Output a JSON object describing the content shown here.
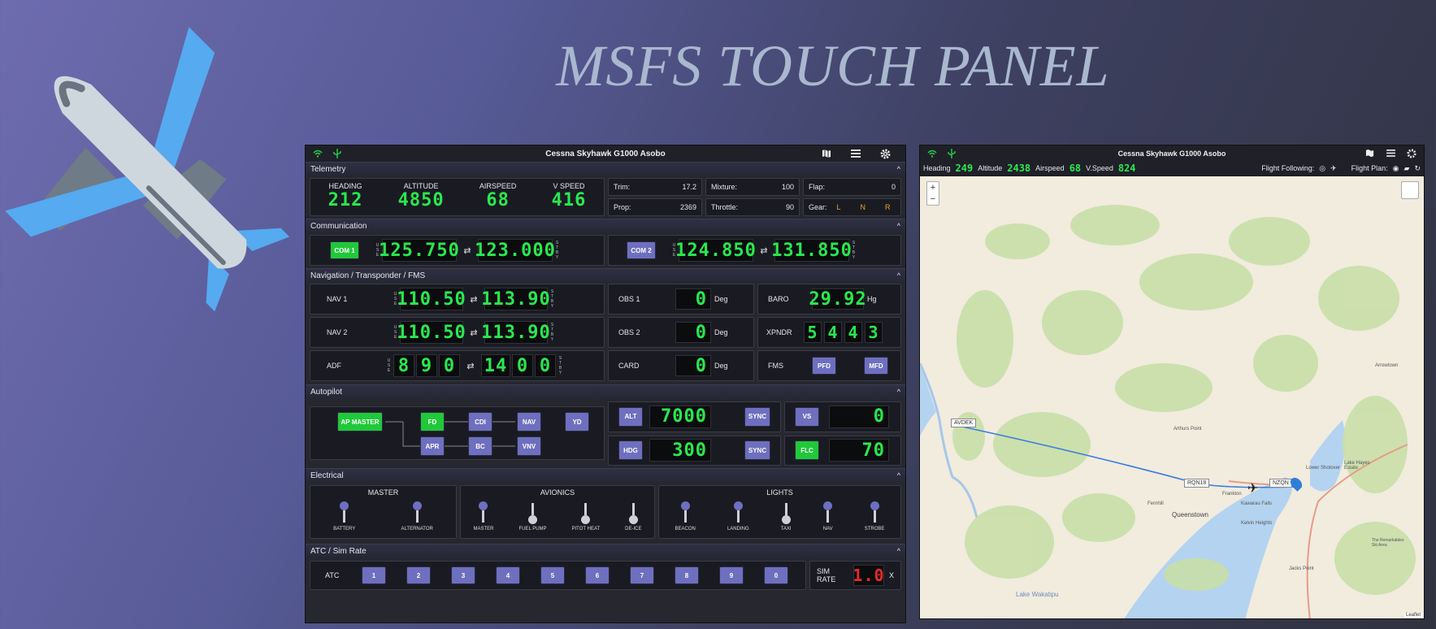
{
  "title": "MSFS TOUCH PANEL",
  "panel": {
    "aircraft": "Cessna Skyhawk G1000 Asobo",
    "telemetry": {
      "header": "Telemetry",
      "gauges": [
        {
          "label": "HEADING",
          "value": "212"
        },
        {
          "label": "ALTITUDE",
          "value": "4850"
        },
        {
          "label": "AIRSPEED",
          "value": "68"
        },
        {
          "label": "V SPEED",
          "value": "416"
        }
      ],
      "trim_label": "Trim:",
      "trim": "17.2",
      "mixture_label": "Mixture:",
      "mixture": "100",
      "flap_label": "Flap:",
      "flap": "0",
      "prop_label": "Prop:",
      "prop": "2369",
      "throttle_label": "Throttle:",
      "throttle": "90",
      "gear_label": "Gear:",
      "gear": [
        "L",
        "N",
        "R"
      ]
    },
    "communication": {
      "header": "Communication",
      "com1": {
        "label": "COM 1",
        "active": "125.750",
        "standby": "123.000"
      },
      "com2": {
        "label": "COM 2",
        "active": "124.850",
        "standby": "131.850"
      },
      "use": "USE",
      "stby": "STBY"
    },
    "navigation": {
      "header": "Navigation / Transponder / FMS",
      "nav1": {
        "label": "NAV 1",
        "active": "110.50",
        "standby": "113.90"
      },
      "nav2": {
        "label": "NAV 2",
        "active": "110.50",
        "standby": "113.90"
      },
      "adf": {
        "label": "ADF",
        "active": [
          "8",
          "9",
          "0"
        ],
        "standby": [
          "14",
          "0",
          "0"
        ]
      },
      "obs1": {
        "label": "OBS 1",
        "value": "0",
        "unit": "Deg"
      },
      "obs2": {
        "label": "OBS 2",
        "value": "0",
        "unit": "Deg"
      },
      "card": {
        "label": "CARD",
        "value": "0",
        "unit": "Deg"
      },
      "baro": {
        "label": "BARO",
        "value": "29.92",
        "unit": "Hg"
      },
      "xpndr": {
        "label": "XPNDR",
        "digits": [
          "5",
          "4",
          "4",
          "3"
        ]
      },
      "fms": {
        "label": "FMS",
        "pfd": "PFD",
        "mfd": "MFD"
      }
    },
    "autopilot": {
      "header": "Autopilot",
      "master": "AP MASTER",
      "fd": "FD",
      "cdi": "CDI",
      "nav": "NAV",
      "yd": "YD",
      "apr": "APR",
      "bc": "BC",
      "vnv": "VNV",
      "alt": "ALT",
      "alt_value": "7000",
      "sync": "SYNC",
      "hdg": "HDG",
      "hdg_value": "300",
      "vs": "VS",
      "vs_value": "0",
      "flc": "FLC",
      "flc_value": "70"
    },
    "electrical": {
      "header": "Electrical",
      "master_title": "MASTER",
      "avionics_title": "AVIONICS",
      "lights_title": "LIGHTS",
      "master": [
        "BATTERY",
        "ALTERNATOR"
      ],
      "avionics": [
        "MASTER",
        "FUEL PUMP",
        "PITOT HEAT",
        "DE-ICE"
      ],
      "lights": [
        "BEACON",
        "LANDING",
        "TAXI",
        "NAV",
        "STROBE"
      ]
    },
    "atc": {
      "header": "ATC / Sim Rate",
      "label": "ATC",
      "keys": [
        "1",
        "2",
        "3",
        "4",
        "5",
        "6",
        "7",
        "8",
        "9",
        "0"
      ],
      "simrate_label": "SIM RATE",
      "simrate": "1.0",
      "x": "X"
    }
  },
  "map": {
    "aircraft": "Cessna Skyhawk G1000 Asobo",
    "heading_label": "Heading",
    "heading": "249",
    "altitude_label": "Altitude",
    "altitude": "2438",
    "airspeed_label": "Airspeed",
    "airspeed": "68",
    "vspeed_label": "V.Speed",
    "vspeed": "824",
    "following_label": "Flight Following:",
    "plan_label": "Flight Plan:",
    "zoom_in": "+",
    "zoom_out": "−",
    "waypoints": [
      "AVDEK",
      "RQN18",
      "NZQN"
    ],
    "places": [
      "Arthurs Point",
      "Lower Shotover",
      "Lake Hayes Estate",
      "Arrowtown",
      "Queenstown",
      "Kawarau Falls",
      "Frankton",
      "Kelvin Heights",
      "Fernhill",
      "Jacks Point",
      "Lake Wakatipu",
      "The Remarkables Ski Area"
    ],
    "attribution": "Leaflet"
  }
}
